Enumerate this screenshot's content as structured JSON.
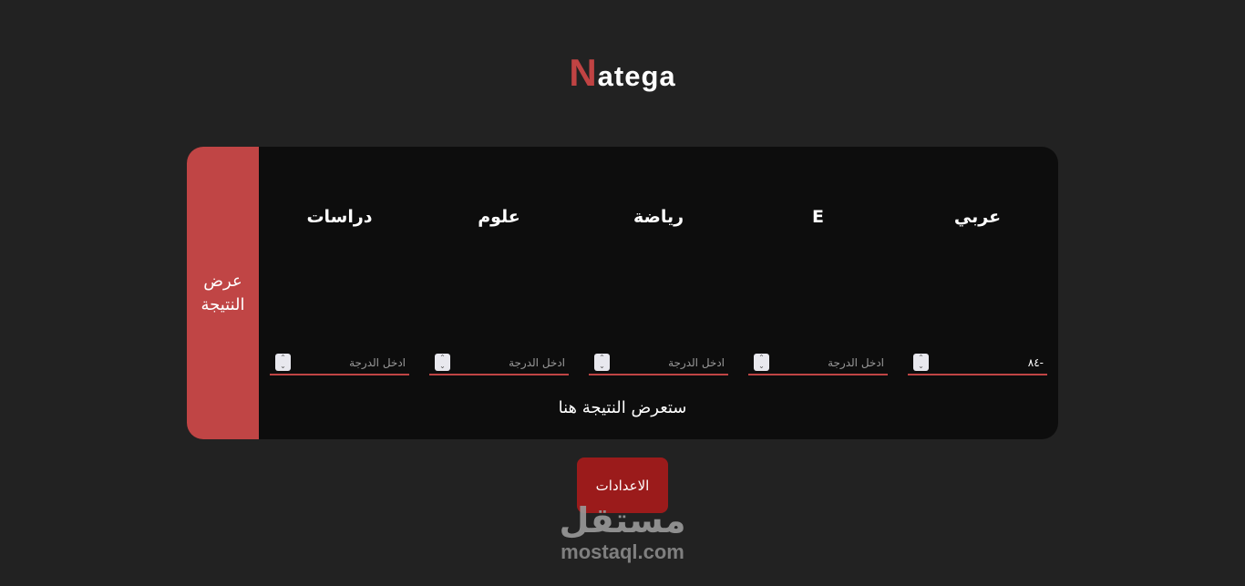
{
  "logo": {
    "first_letter": "N",
    "rest": "atega"
  },
  "show_result_button": "عرض النتيجة",
  "subjects": [
    {
      "label": "دراسات",
      "value": "",
      "placeholder": "ادخل الدرجة"
    },
    {
      "label": "علوم",
      "value": "",
      "placeholder": "ادخل الدرجة"
    },
    {
      "label": "رياضة",
      "value": "",
      "placeholder": "ادخل الدرجة"
    },
    {
      "label": "E",
      "value": "",
      "placeholder": "ادخل الدرجة"
    },
    {
      "label": "عربي",
      "value": "-٨٤",
      "placeholder": "ادخل الدرجة"
    }
  ],
  "result_text": "ستعرض النتيجة هنا",
  "settings_button": "الاعدادات",
  "watermark": {
    "arabic": "مستقل",
    "latin": "mostaql.com"
  },
  "colors": {
    "background": "#222222",
    "card": "#0d0d0d",
    "accent": "#c04545",
    "settings": "#9b1b1b"
  }
}
